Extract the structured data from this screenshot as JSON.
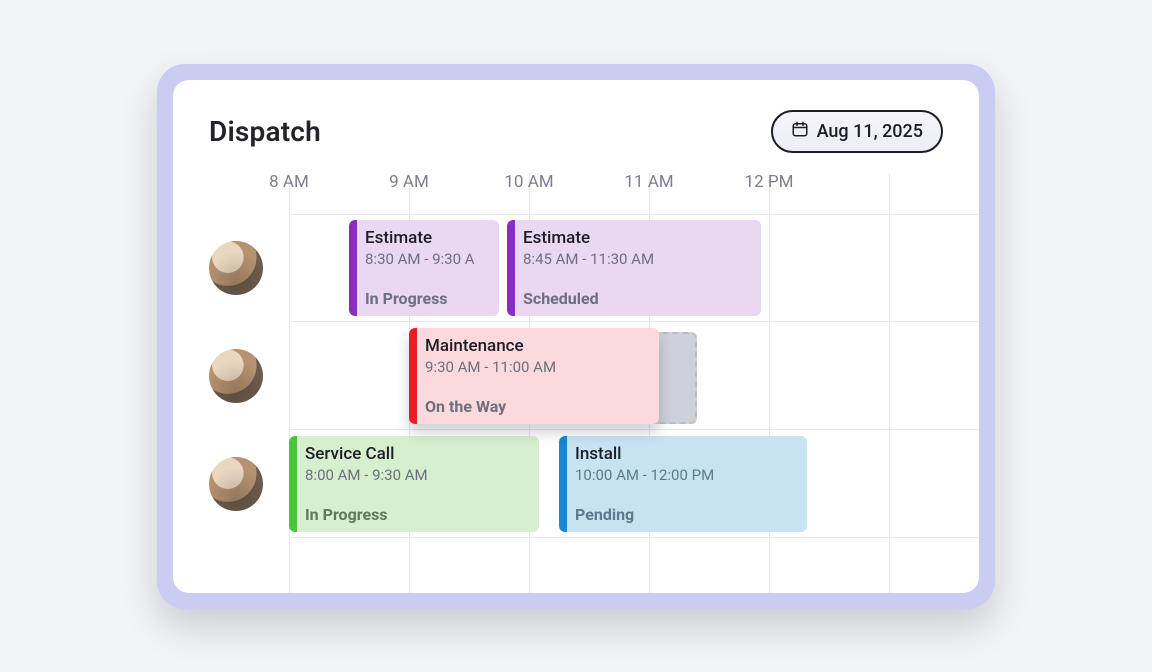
{
  "header": {
    "title": "Dispatch",
    "date_label": "Aug 11, 2025"
  },
  "time_axis": {
    "labels": [
      "8 AM",
      "9 AM",
      "10 AM",
      "11 AM",
      "12 PM"
    ]
  },
  "rows": [
    {
      "tech": "tech-1"
    },
    {
      "tech": "tech-2"
    },
    {
      "tech": "tech-3"
    }
  ],
  "cards": {
    "estimate_a": {
      "title": "Estimate",
      "time": "8:30 AM - 9:30 A",
      "status": "In Progress"
    },
    "estimate_b": {
      "title": "Estimate",
      "time": "8:45 AM - 11:30 AM",
      "status": "Scheduled"
    },
    "maintenance": {
      "title": "Maintenance",
      "time": "9:30 AM - 11:00 AM",
      "status": "On the Way"
    },
    "service_call": {
      "title": "Service Call",
      "time": "8:00 AM - 9:30 AM",
      "status": "In Progress"
    },
    "install": {
      "title": "Install",
      "time": "10:00 AM - 12:00 PM",
      "status": "Pending"
    }
  }
}
